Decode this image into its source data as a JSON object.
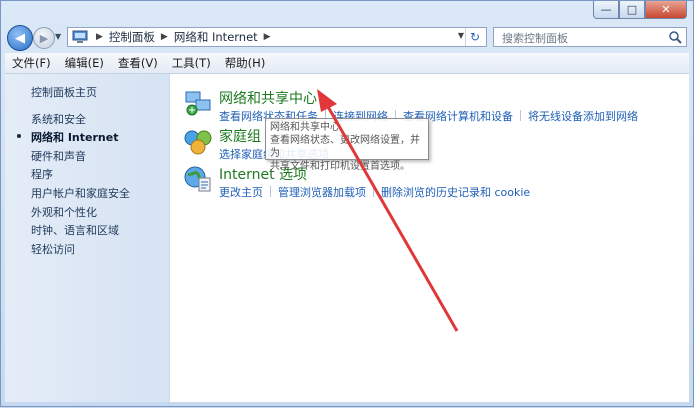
{
  "window": {
    "controls": {
      "minimize": "—",
      "maximize": "□",
      "close": "✕"
    }
  },
  "nav": {
    "back_glyph": "◀",
    "forward_glyph": "▶",
    "breadcrumb": [
      "控制面板",
      "网络和 Internet"
    ],
    "search_placeholder": "搜索控制面板",
    "refresh_glyph": "↻"
  },
  "menu": [
    "文件(F)",
    "编辑(E)",
    "查看(V)",
    "工具(T)",
    "帮助(H)"
  ],
  "sidebar": {
    "home": "控制面板主页",
    "items": [
      "系统和安全",
      "网络和 Internet",
      "硬件和声音",
      "程序",
      "用户帐户和家庭安全",
      "外观和个性化",
      "时钟、语言和区域",
      "轻松访问"
    ],
    "current_index": 1
  },
  "categories": [
    {
      "title": "网络和共享中心",
      "icon": "network-sharing-icon",
      "links": [
        "查看网络状态和任务",
        "连接到网络",
        "查看网络计算机和设备",
        "将无线设备添加到网络"
      ]
    },
    {
      "title": "家庭组",
      "icon": "homegroup-icon",
      "links": [
        "选择家庭组和共享选项"
      ]
    },
    {
      "title": "Internet 选项",
      "icon": "internet-options-icon",
      "links": [
        "更改主页",
        "管理浏览器加载项",
        "删除浏览的历史记录和 cookie"
      ]
    }
  ],
  "tooltip": {
    "title": "网络和共享中心",
    "body_line1": "查看网络状态、更改网络设置，并为",
    "body_line2": "共享文件和打印机设置首选项。"
  },
  "colors": {
    "link": "#1f5fb7",
    "category_title": "#1c7a1f",
    "annotation_arrow": "#e0383a"
  }
}
